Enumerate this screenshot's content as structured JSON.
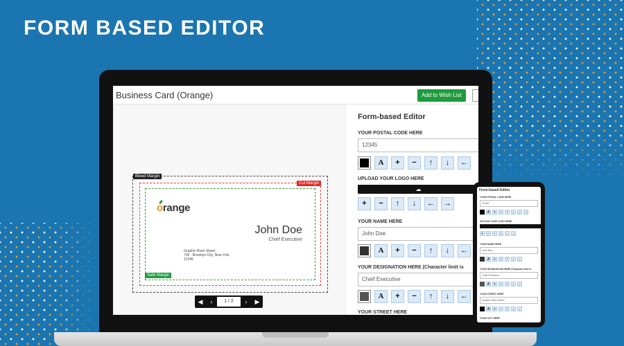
{
  "banner": {
    "headline": "FORM BASED EDITOR"
  },
  "app": {
    "title": "Business Card (Orange)",
    "wishlist_label": "Add to Wish List",
    "canvas": {
      "bleed_label": "Bleed Margin",
      "cut_label": "Cut Margin",
      "safe_label": "Safe Margin",
      "card": {
        "brand_prefix": "o",
        "brand_rest": "range",
        "name": "John Doe",
        "role": "Chief Executive",
        "address_1": "Graphic River Street",
        "address_2": "736 - Brooklyn City, New York",
        "address_3": "12345"
      },
      "pager": {
        "first": "◀",
        "prev": "‹",
        "indicator": "1 / 2",
        "next": "›",
        "last": "▶"
      }
    },
    "panel": {
      "title": "Form-based Editor",
      "postal_label": "YOUR POSTAL CODE HERE",
      "postal_value": "12345",
      "upload_label": "UPLOAD YOUR LOGO HERE",
      "name_label": "YOUR NAME HERE",
      "name_value": "John Doe",
      "designation_label": "YOUR DESIGNATION HERE (Character limit is",
      "designation_value": "Chief Executive",
      "street_label": "YOUR STREET HERE",
      "tool_icons": {
        "font": "A",
        "plus": "+",
        "minus": "−",
        "up": "↑",
        "down": "↓",
        "left": "←"
      },
      "colors": {
        "postal": "#000000",
        "name": "#333333",
        "designation": "#555555"
      }
    }
  },
  "phone": {
    "title": "Form-based Editor",
    "postal_label": "YOUR POSTAL CODE HERE",
    "postal_value": "12345",
    "upload_label": "UPLOAD YOUR LOGO HERE",
    "name_label": "YOUR NAME HERE",
    "name_value": "John Doe",
    "designation_label": "YOUR DESIGNATION HERE (Character limit is",
    "designation_value": "Chief Executive",
    "street_label": "YOUR STREET HERE",
    "street_value": "Graphic River Street",
    "city_label": "YOUR CITY HERE"
  },
  "colors": {
    "background": "#1a75b0",
    "accent_green": "#1d9b3d",
    "brand_orange": "#f28c1e",
    "tool_bg": "#dbeaf8"
  }
}
